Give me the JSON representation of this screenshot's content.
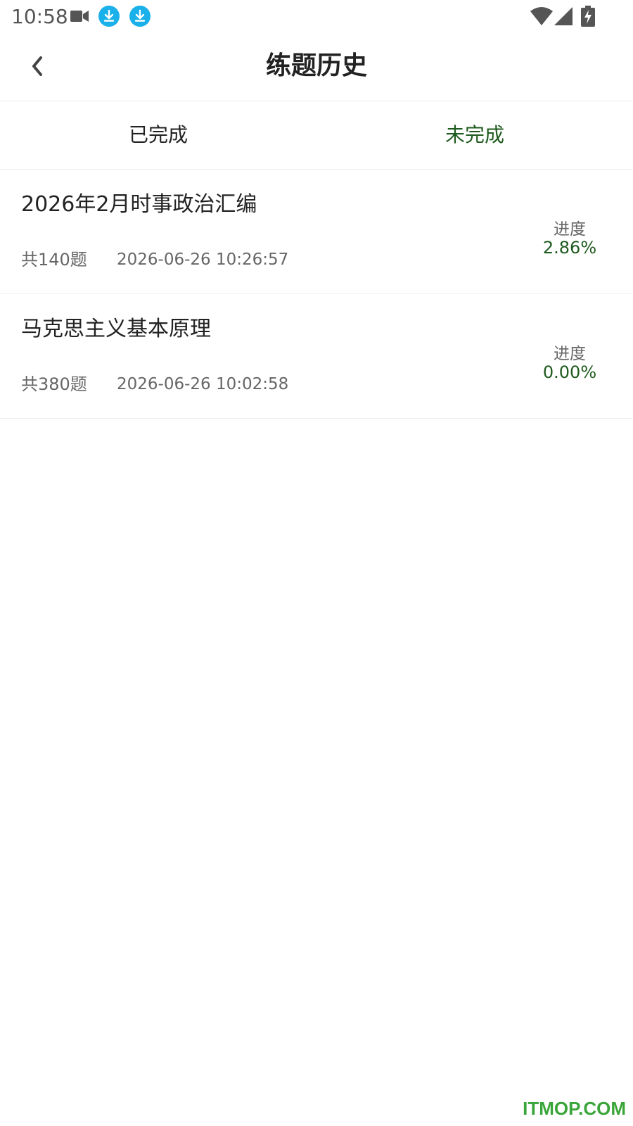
{
  "status_bar": {
    "time": "10:58",
    "icons": [
      "video-camera-icon",
      "download-icon",
      "download-icon",
      "wifi-icon",
      "signal-icon",
      "battery-charging-icon"
    ],
    "download_icon_color": "#1ab0ea"
  },
  "header": {
    "title": "练题历史",
    "back_icon": "chevron-left-icon"
  },
  "tabs": [
    {
      "label": "已完成",
      "active": false
    },
    {
      "label": "未完成",
      "active": true
    }
  ],
  "colors": {
    "accent": "#1e5a1e",
    "text_primary": "#222222",
    "text_secondary": "#666666",
    "divider": "#eeeeee",
    "watermark": "#3aa53a"
  },
  "history": [
    {
      "title": "2026年2月时事政治汇编",
      "count": "共140题",
      "time": "2026-06-26 10:26:57",
      "progress_label": "进度",
      "progress": "2.86%"
    },
    {
      "title": "马克思主义基本原理",
      "count": "共380题",
      "time": "2026-06-26 10:02:58",
      "progress_label": "进度",
      "progress": "0.00%"
    }
  ],
  "watermark": "ITMOP.COM"
}
